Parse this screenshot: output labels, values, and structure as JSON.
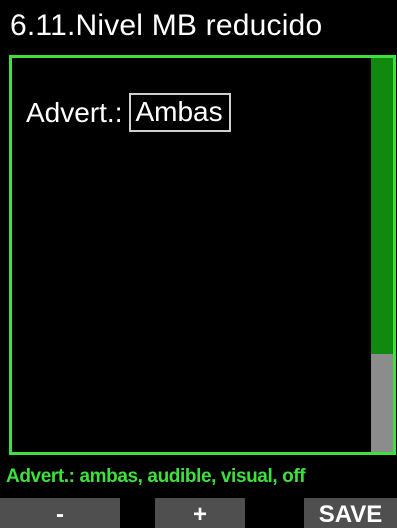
{
  "header": {
    "title": "6.11.Nivel MB reducido"
  },
  "setting": {
    "label": "Advert.:",
    "value": "Ambas"
  },
  "scrollbar": {
    "visible_fraction": 0.75,
    "thumb_color": "#0f8a0f",
    "track_color": "#8c8c8c"
  },
  "hint": {
    "text": "Advert.: ambas, audible, visual, off"
  },
  "softkeys": {
    "minus": "-",
    "plus": "+",
    "save": "SAVE"
  },
  "colors": {
    "accent": "#3ce13c",
    "background": "#000000",
    "softkey": "#4f4f4f"
  }
}
